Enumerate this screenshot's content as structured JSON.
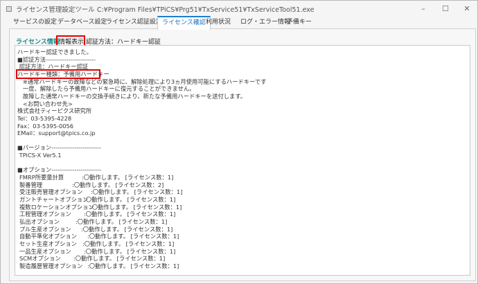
{
  "window": {
    "title": "ライセンス管理設定ツール  C:¥Program Files¥TPiCS¥Prg51¥TxService51¥TxServiceTool51.exe",
    "minimize": "–",
    "maximize": "☐",
    "close": "✕"
  },
  "tabs": [
    "サービスの設定",
    "データベース設定",
    "ライセンス認証設定",
    "ライセンス確認",
    "利用状況",
    "ログ・エラー情報",
    "予備キー"
  ],
  "sub": {
    "license_info": "ライセンス情報",
    "show_info": "情報表示",
    "auth_method": "認証方法：ハードキー認証"
  },
  "lines": [
    "ハードキー認証できました。",
    "■認証方法------------------------",
    " 認証方法：ハードキー認証",
    "ハードキー種類：予備用ハードキー",
    "   ※通常ハードキーの故障などの緊急時に、解除処理により3ヵ月使用可能にするハードキーです",
    "   一度、解除したら予備用ハードキーに復元することができません。",
    "   故障した通常ハードキーの交換手続きにより、新たな予備用ハードキーを送付します。",
    "   <お問い合わせ先>",
    "株式会社ティーピクス研究所",
    "Tel：03-5395-4228",
    "Fax：03-5395-0056",
    "EMail：support@tpics.co.jp",
    "",
    "■バージョン------------------------",
    " TPiCS-X Ver5.1",
    "",
    "■オプション------------------------"
  ],
  "options": [
    {
      "name": "FMRP所要量計算",
      "status": ":〇動作します。 [ライセンス数：1]"
    },
    {
      "name": "製番管理",
      "status": ":〇動作します。 [ライセンス数：2]"
    },
    {
      "name": "受注販売管理オプション",
      "status": ":〇動作します。 [ライセンス数：1]"
    },
    {
      "name": "ガントチャートオプション",
      "status": ":〇動作します。 [ライセンス数：1]"
    },
    {
      "name": "複数ロケーションオプション",
      "status": ":〇動作します。 [ライセンス数：1]"
    },
    {
      "name": "工程管理オプション",
      "status": ":〇動作します。 [ライセンス数：1]"
    },
    {
      "name": "払出オプション",
      "status": ":〇動作します。 [ライセンス数：1]"
    },
    {
      "name": "プル生産オプション",
      "status": ":〇動作します。 [ライセンス数：1]"
    },
    {
      "name": "自動平準化オプション",
      "status": ":〇動作します。 [ライセンス数：1]"
    },
    {
      "name": "セット生産オプション",
      "status": ":〇動作します。 [ライセンス数：1]"
    },
    {
      "name": "一品生産オプション",
      "status": ":〇動作します。 [ライセンス数：1]"
    },
    {
      "name": "SCMオプション",
      "status": ":〇動作します。 [ライセンス数：1]"
    },
    {
      "name": "製造履歴管理オプション",
      "status": ":〇動作します。 [ライセンス数：1]"
    }
  ]
}
